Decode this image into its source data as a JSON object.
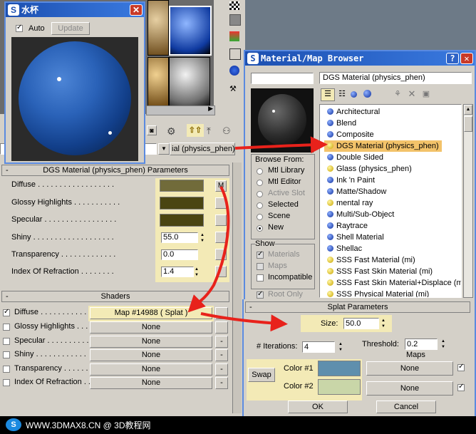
{
  "colors": {
    "accent_red": "#e8221b",
    "highlight": "#f3eab6",
    "sphere": "#2a62b8",
    "title_blue": "#1c4fb0"
  },
  "preview_window": {
    "title": "水杯",
    "auto_label": "Auto",
    "update_label": "Update"
  },
  "browser_window": {
    "title": "Material/Map Browser",
    "search_value": "DGS Material (physics_phen)",
    "browse_from": {
      "title": "Browse From:",
      "options": [
        "Mtl Library",
        "Mtl Editor",
        "Active Slot",
        "Selected",
        "Scene",
        "New"
      ],
      "selected": "New"
    },
    "show": {
      "title": "Show",
      "options": [
        "Materials",
        "Maps",
        "Incompatible"
      ]
    },
    "root_only": "Root Only",
    "list": [
      {
        "label": "Architectural",
        "icon": "blue-sphere-icon"
      },
      {
        "label": "Blend",
        "icon": "blue-sphere-icon"
      },
      {
        "label": "Composite",
        "icon": "blue-sphere-icon"
      },
      {
        "label": "DGS Material (physics_phen)",
        "icon": "yellow-sphere-icon",
        "selected": true
      },
      {
        "label": "Double Sided",
        "icon": "blue-sphere-icon"
      },
      {
        "label": "Glass (physics_phen)",
        "icon": "yellow-sphere-icon"
      },
      {
        "label": "Ink 'n Paint",
        "icon": "blue-sphere-icon"
      },
      {
        "label": "Matte/Shadow",
        "icon": "blue-sphere-icon"
      },
      {
        "label": "mental ray",
        "icon": "yellow-sphere-icon"
      },
      {
        "label": "Multi/Sub-Object",
        "icon": "blue-sphere-icon"
      },
      {
        "label": "Raytrace",
        "icon": "blue-sphere-icon"
      },
      {
        "label": "Shell Material",
        "icon": "blue-sphere-icon"
      },
      {
        "label": "Shellac",
        "icon": "blue-sphere-icon"
      },
      {
        "label": "SSS Fast Material (mi)",
        "icon": "yellow-sphere-icon"
      },
      {
        "label": "SSS Fast Skin Material (mi)",
        "icon": "yellow-sphere-icon"
      },
      {
        "label": "SSS Fast Skin Material+Displace (mi",
        "icon": "yellow-sphere-icon"
      },
      {
        "label": "SSS Physical Material (mi)",
        "icon": "yellow-sphere-icon"
      }
    ]
  },
  "editor": {
    "material_type": "ial (physics_phen)",
    "params_title": "DGS Material (physics_phen) Parameters",
    "params": [
      {
        "label": "Diffuse . . . . . . . . . . . . . . . . . .",
        "kind": "swatch"
      },
      {
        "label": "Glossy Highlights . . . . . . . . . . .",
        "kind": "swatch"
      },
      {
        "label": "Specular . . . . . . . . . . . . . . . . .",
        "kind": "swatch"
      },
      {
        "label": "Shiny . . . . . . . . . . . . . . . . . . .",
        "value": "55.0"
      },
      {
        "label": "Transparency . . . . . . . . . . . . .",
        "value": "0.0"
      },
      {
        "label": "Index Of Refraction . . . . . . . .",
        "value": "1.4"
      }
    ],
    "diffuse_map_btn": "M",
    "shaders_title": "Shaders",
    "shaders": [
      {
        "label": "Diffuse . . . . . . . . . . .",
        "map": "Map #14988  ( Splat )",
        "checked": true
      },
      {
        "label": "Glossy Highlights . . . .",
        "map": "None",
        "checked": false
      },
      {
        "label": "Specular . . . . . . . . . .",
        "map": "None",
        "checked": false
      },
      {
        "label": "Shiny . . . . . . . . . . . .",
        "map": "None",
        "checked": false
      },
      {
        "label": "Transparency . . . . . .",
        "map": "None",
        "checked": false
      },
      {
        "label": "Index Of Refraction . . .",
        "map": "None",
        "checked": false
      }
    ],
    "dash": "-"
  },
  "splat": {
    "title": "Splat Parameters",
    "size_label": "Size:",
    "size_value": "50.0",
    "iterations_label": "# Iterations:",
    "iterations_value": "4",
    "threshold_label": "Threshold:",
    "threshold_value": "0.2",
    "maps_label": "Maps",
    "swap_label": "Swap",
    "color1_label": "Color #1",
    "color2_label": "Color #2",
    "map1": "None",
    "map2": "None",
    "color1": "#5f8fad",
    "color2": "#c9d6a8"
  },
  "dialog_buttons": {
    "ok": "OK",
    "cancel": "Cancel"
  },
  "footer": {
    "watermark": "WWW.3DMAX8.CN @ 3D教程网"
  }
}
